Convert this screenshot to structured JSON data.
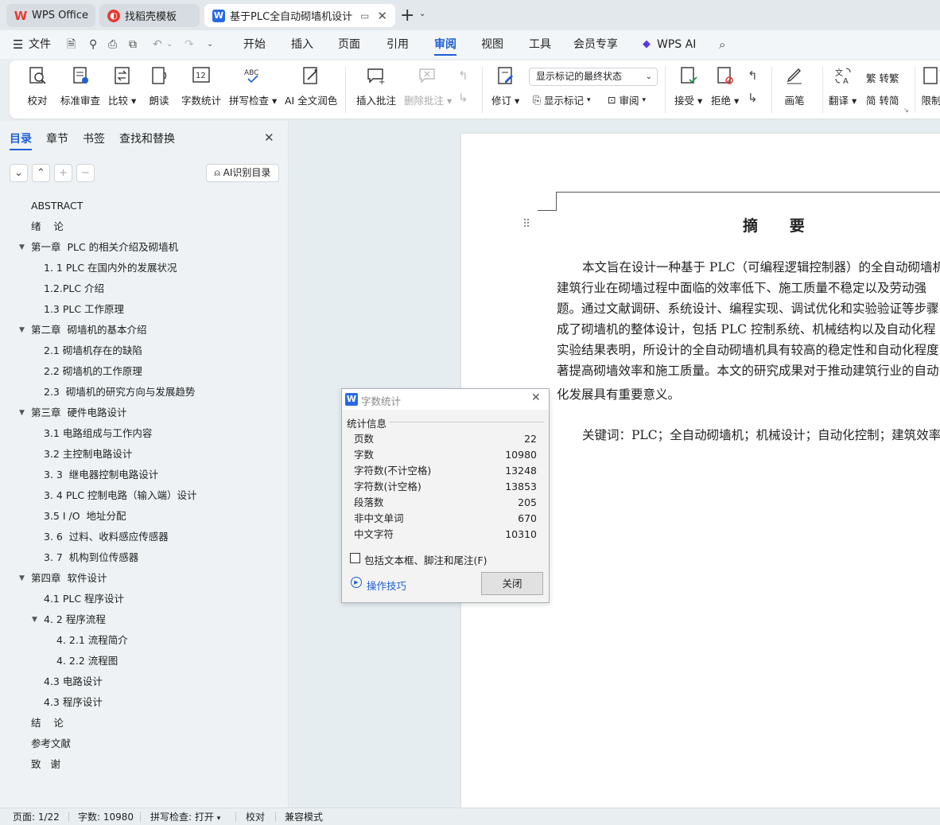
{
  "tabs": [
    {
      "label": "WPS Office"
    },
    {
      "label": "找稻壳模板"
    },
    {
      "label": "基于PLC全自动砌墙机设计 毕"
    }
  ],
  "menu": {
    "file": "文件",
    "items": [
      "开始",
      "插入",
      "页面",
      "引用",
      "审阅",
      "视图",
      "工具",
      "会员专享"
    ],
    "active": "审阅",
    "wps_ai": "WPS AI"
  },
  "ribbon": {
    "proofread": "校对",
    "standard_review": "标准审查",
    "compare": "比较",
    "read_aloud": "朗读",
    "word_count": "字数统计",
    "spell_check": "拼写检查",
    "ai_polish": "AI 全文润色",
    "insert_comment": "插入批注",
    "delete_comment": "删除批注",
    "track_changes": "修订",
    "display_dropdown": "显示标记的最终状态",
    "show_markup": "显示标记",
    "review": "审阅",
    "accept": "接受",
    "reject": "拒绝",
    "pen": "画笔",
    "translate": "翻译",
    "to_traditional": "转繁",
    "to_simplified": "转简",
    "restrict": "限制"
  },
  "sidebar": {
    "tabs": [
      "目录",
      "章节",
      "书签",
      "查找和替换"
    ],
    "active_tab": "目录",
    "ai_button": "AI识别目录",
    "toc": [
      {
        "text": "ABSTRACT",
        "level": 1
      },
      {
        "text": "绪    论",
        "level": 1
      },
      {
        "text": "第一章  PLC 的相关介绍及砌墙机",
        "level": 1,
        "expanded": true
      },
      {
        "text": "1. 1 PLC 在国内外的发展状况",
        "level": 2
      },
      {
        "text": "1.2.PLC 介绍",
        "level": 2
      },
      {
        "text": "1.3 PLC 工作原理",
        "level": 2
      },
      {
        "text": "第二章  砌墙机的基本介绍",
        "level": 1,
        "expanded": true
      },
      {
        "text": "2.1 砌墙机存在的缺陷",
        "level": 2
      },
      {
        "text": "2.2 砌墙机的工作原理",
        "level": 2
      },
      {
        "text": "2.3  砌墙机的研究方向与发展趋势",
        "level": 2
      },
      {
        "text": "第三章  硬件电路设计",
        "level": 1,
        "expanded": true
      },
      {
        "text": "3.1 电路组成与工作内容",
        "level": 2
      },
      {
        "text": "3.2 主控制电路设计",
        "level": 2
      },
      {
        "text": "3. 3  继电器控制电路设计",
        "level": 2
      },
      {
        "text": "3. 4 PLC 控制电路（输入端）设计",
        "level": 2
      },
      {
        "text": "3.5 I /O  地址分配",
        "level": 2
      },
      {
        "text": "3. 6  过料、收料感应传感器",
        "level": 2
      },
      {
        "text": "3. 7  机构到位传感器",
        "level": 2
      },
      {
        "text": "第四章  软件设计",
        "level": 1,
        "expanded": true
      },
      {
        "text": "4.1 PLC 程序设计",
        "level": 2
      },
      {
        "text": "4. 2 程序流程",
        "level": 2,
        "expanded": true
      },
      {
        "text": "4. 2.1 流程简介",
        "level": 3
      },
      {
        "text": "4. 2.2 流程图",
        "level": 3
      },
      {
        "text": "4.3 电路设计",
        "level": 2
      },
      {
        "text": "4.3 程序设计",
        "level": 2
      },
      {
        "text": "结    论",
        "level": 1
      },
      {
        "text": "参考文献",
        "level": 1
      },
      {
        "text": "致   谢",
        "level": 1
      }
    ]
  },
  "document": {
    "heading": "摘      要",
    "lines": [
      "本文旨在设计一种基于 PLC（可编程逻辑控制器）的全自动砌墙机",
      "建筑行业在砌墙过程中面临的效率低下、施工质量不稳定以及劳动强",
      "题。通过文献调研、系统设计、编程实现、调试优化和实验验证等步骤",
      "成了砌墙机的整体设计，包括 PLC 控制系统、机械结构以及自动化程",
      "实验结果表明，所设计的全自动砌墙机具有较高的稳定性和自动化程度",
      "著提高砌墙效率和施工质量。本文的研究成果对于推动建筑行业的自动",
      "化发展具有重要意义。"
    ],
    "keywords": "关键词：PLC；全自动砌墙机；机械设计；自动化控制；建筑效率"
  },
  "dialog": {
    "title": "字数统计",
    "section": "统计信息",
    "stats": [
      {
        "label": "页数",
        "value": "22"
      },
      {
        "label": "字数",
        "value": "10980"
      },
      {
        "label": "字符数(不计空格)",
        "value": "13248"
      },
      {
        "label": "字符数(计空格)",
        "value": "13853"
      },
      {
        "label": "段落数",
        "value": "205"
      },
      {
        "label": "非中文单词",
        "value": "670"
      },
      {
        "label": "中文字符",
        "value": "10310"
      }
    ],
    "checkbox_label": "包括文本框、脚注和尾注(F)",
    "checkbox_checked": false,
    "tips": "操作技巧",
    "close": "关闭"
  },
  "status": {
    "page": "页面: 1/22",
    "words": "字数: 10980",
    "spell": "拼写检查: 打开",
    "proof": "校对",
    "mode": "兼容模式"
  },
  "colors": {
    "accent": "#1f5fd6",
    "wps_red": "#e23c35",
    "word_blue": "#2a6ae0"
  }
}
